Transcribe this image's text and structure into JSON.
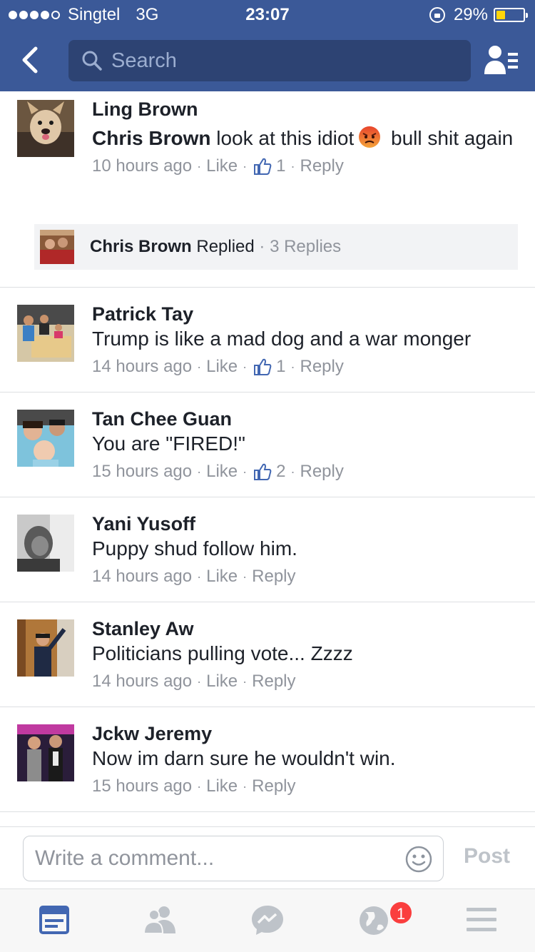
{
  "status_bar": {
    "carrier": "Singtel",
    "network": "3G",
    "time": "23:07",
    "battery": "29%",
    "battery_level": 0.29,
    "signal_bars": 4,
    "icons": [
      "signal-dots-icon",
      "rotation-lock-icon",
      "battery-icon"
    ]
  },
  "nav": {
    "search_placeholder": "Search",
    "icons": [
      "back-icon",
      "search-icon",
      "friends-list-icon"
    ]
  },
  "comments": [
    {
      "author": "Ling Brown",
      "mention": "Chris Brown",
      "text": " look at this idiot",
      "emoji": "angry-face-icon",
      "text_after": " bull shit again",
      "time": "10 hours ago",
      "like_label": "Like",
      "likes": "1",
      "reply_label": "Reply",
      "replied": {
        "name": "Chris Brown",
        "action": " Replied",
        "separator": " · ",
        "count": "3 Replies"
      }
    },
    {
      "author": "Patrick Tay",
      "text": "Trump is like a mad dog and a war monger",
      "time": "14 hours ago",
      "like_label": "Like",
      "likes": "1",
      "reply_label": "Reply"
    },
    {
      "author": "Tan Chee Guan",
      "text": "You are \"FIRED!\"",
      "time": "15 hours ago",
      "like_label": "Like",
      "likes": "2",
      "reply_label": "Reply"
    },
    {
      "author": "Yani Yusoff",
      "text": "Puppy shud follow him.",
      "time": "14 hours ago",
      "like_label": "Like",
      "reply_label": "Reply"
    },
    {
      "author": "Stanley Aw",
      "text": "Politicians pulling vote... Zzzz",
      "time": "14 hours ago",
      "like_label": "Like",
      "reply_label": "Reply"
    },
    {
      "author": "Jckw Jeremy",
      "text": "Now im darn sure he wouldn't win.",
      "time": "15 hours ago",
      "like_label": "Like",
      "reply_label": "Reply"
    }
  ],
  "composer": {
    "placeholder": "Write a comment...",
    "post_label": "Post",
    "icons": [
      "smiley-icon"
    ]
  },
  "tab_bar": {
    "tabs": [
      "news-feed-icon",
      "friend-requests-icon",
      "messenger-icon",
      "notifications-globe-icon",
      "menu-icon"
    ],
    "active": "news-feed-icon",
    "notification_badge": "1"
  },
  "colors": {
    "brand_blue": "#3b5998",
    "search_bg": "#2d4373",
    "meta_gray": "#90949c",
    "tab_active": "#4267b2",
    "tab_inactive": "#bec3c9",
    "badge_red": "#fa3e3e",
    "battery_yellow": "#ffd60a"
  }
}
